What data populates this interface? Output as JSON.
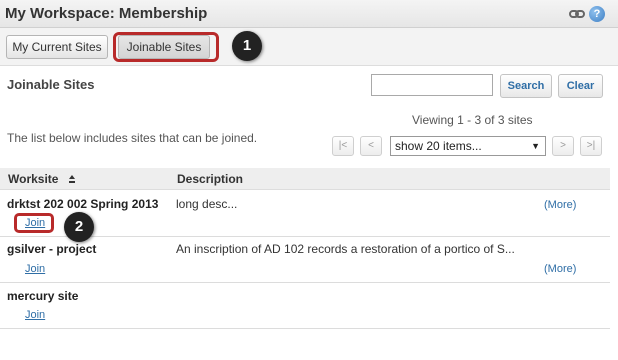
{
  "window": {
    "title": "My Workspace: Membership",
    "help_icon": "help-icon",
    "link_icon": "link-icon"
  },
  "tabs": [
    {
      "label": "My Current Sites",
      "active": false
    },
    {
      "label": "Joinable Sites",
      "active": true
    }
  ],
  "callouts": {
    "badge_1": "1",
    "badge_2": "2",
    "highlight_color": "#b82a2a"
  },
  "section": {
    "heading": "Joinable Sites"
  },
  "search": {
    "value": "",
    "placeholder": "",
    "search_label": "Search",
    "clear_label": "Clear"
  },
  "pager": {
    "viewing": "Viewing 1 - 3 of 3 sites",
    "intro": "The list below includes sites that can be joined.",
    "first": "|<",
    "prev": "<",
    "next": ">",
    "last": ">|",
    "page_size": "show 20 items...",
    "caret": "▼"
  },
  "table": {
    "columns": [
      "Worksite",
      "Description"
    ],
    "rows": [
      {
        "name": "drktst 202 002 Spring 2013",
        "description": "long desc...",
        "join": "Join",
        "more": "(More)"
      },
      {
        "name": "gsilver - project",
        "description": "An inscription of AD 102 records a restoration of a portico of S...",
        "join": "Join",
        "more": "(More)"
      },
      {
        "name": "mercury site",
        "description": "",
        "join": "Join",
        "more": ""
      }
    ]
  },
  "colors": {
    "accent_link": "#2f6ea6",
    "callout_red": "#b82a2a"
  }
}
